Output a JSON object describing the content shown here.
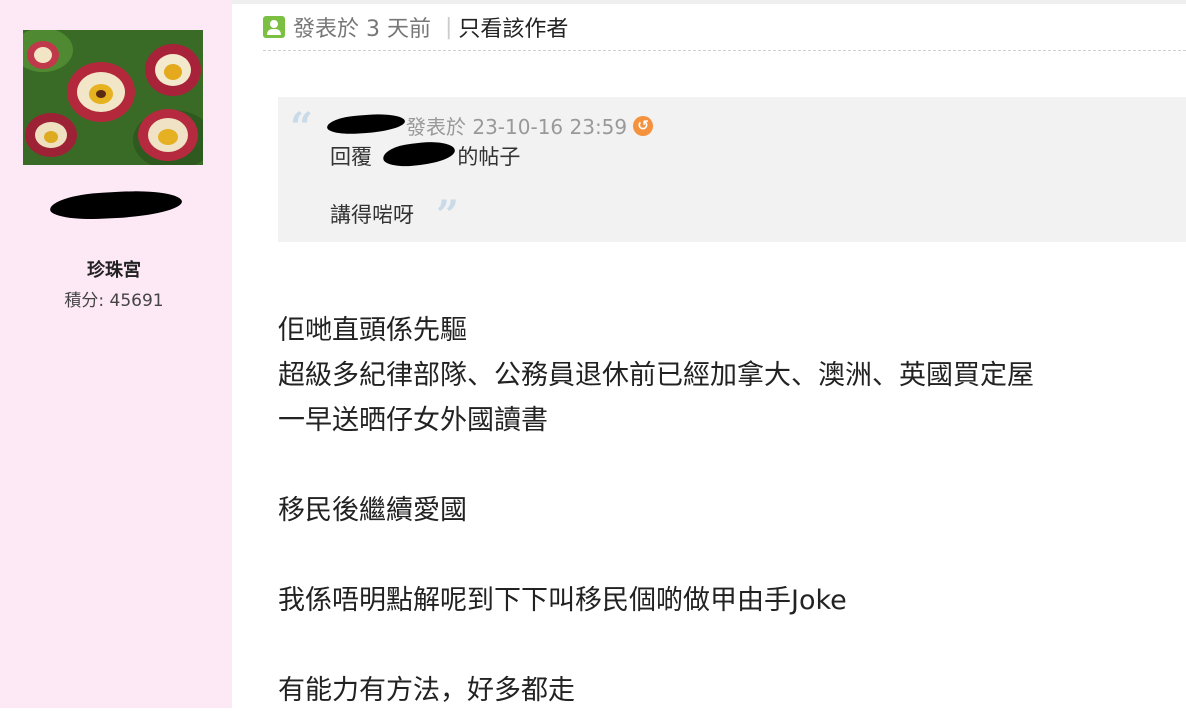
{
  "sidebar": {
    "avatar": {
      "description_icon": "tulip-avatar"
    },
    "username": "",
    "group": "珍珠宮",
    "points_label": "積分: 45691"
  },
  "post": {
    "header": {
      "time": "發表於 3 天前",
      "separator": "|",
      "only_author": "只看該作者"
    },
    "quote": {
      "open_mark": "“",
      "close_mark": "”",
      "author": "",
      "posted": "發表於 23-10-16 23:59",
      "reply_prefix": "回覆",
      "reply_name": "",
      "reply_suffix": "的帖子",
      "text": "講得啱呀"
    },
    "body_lines": [
      "佢哋直頭係先驅",
      "超級多紀律部隊、公務員退休前已經加拿大、澳洲、英國買定屋",
      "一早送晒仔女外國讀書",
      "",
      "移民後繼續愛國",
      "",
      "我係唔明點解呢到下下叫移民個啲做甲由手Joke",
      "",
      "有能力有方法，好多都走"
    ]
  },
  "colors": {
    "sidebar_bg": "#fde8f6",
    "quote_bg": "#f2f2f2",
    "user_icon": "#7bc043",
    "goto_icon": "#f5923e"
  }
}
